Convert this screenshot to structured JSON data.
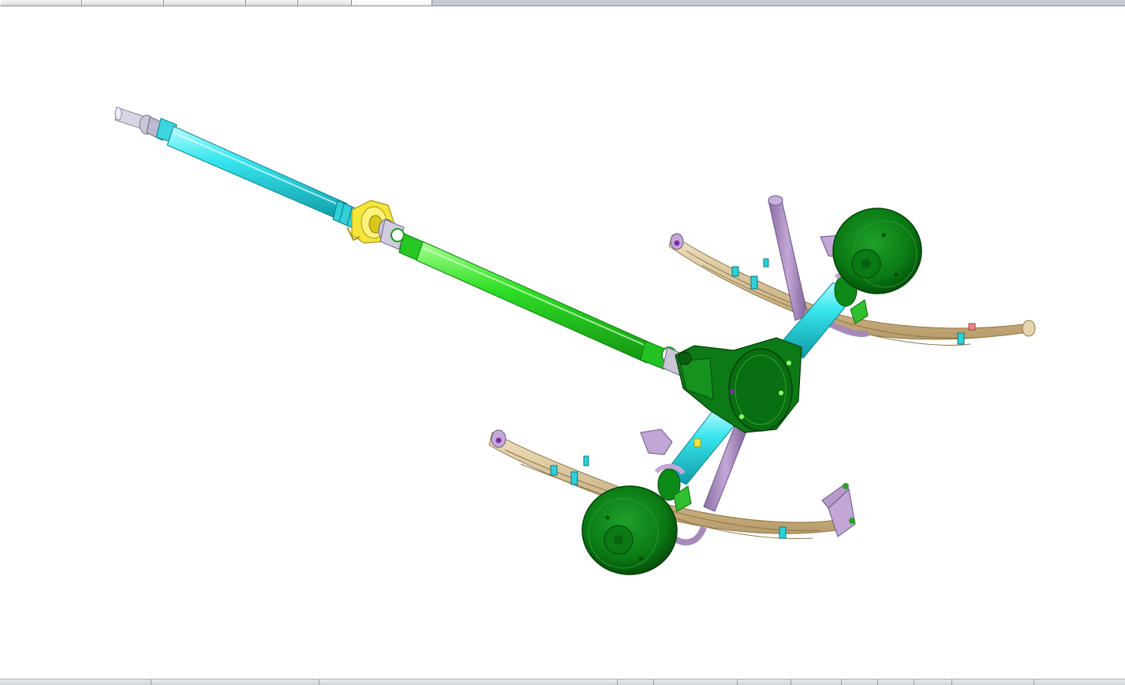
{
  "window": {
    "tabs": [
      {
        "label": ""
      },
      {
        "label": ""
      },
      {
        "label": ""
      },
      {
        "label": ""
      },
      {
        "label": ""
      },
      {
        "label": ""
      }
    ],
    "active_tab_index": 5
  },
  "viewport": {
    "model_name": "",
    "background_color": "#ffffff",
    "part_colors": {
      "front_shaft": "#33e0e6",
      "rear_shaft": "#2edc2e",
      "center_bearing": "#f2e22a",
      "axle_housing": "#0a7a14",
      "axle_tubes": "#33e0e6",
      "brake_drums": "#087310",
      "leaf_springs": "#d8c49a",
      "shock_absorbers": "#a78aba",
      "yoke": "#c9c6d6"
    }
  },
  "status_bar": {
    "cells": [
      "",
      "",
      "",
      "",
      "",
      "",
      "",
      "",
      "",
      "",
      "",
      ""
    ]
  }
}
